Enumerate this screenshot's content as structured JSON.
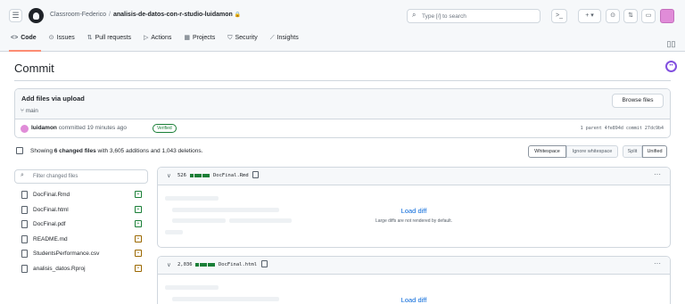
{
  "header": {
    "org": "Classroom-Federico",
    "separator": "/",
    "repo": "analisis-de-datos-con-r-studio-luidamon",
    "lock_glyph": "🔒",
    "search_placeholder": "Type [/] to search",
    "terminal_glyph": ">_",
    "plus_glyph": "+ ▾",
    "issues_glyph": "⊙",
    "pr_glyph": "⇅",
    "inbox_glyph": "▭"
  },
  "repo_nav": {
    "tabs": [
      {
        "icon": "<>",
        "label": "Code"
      },
      {
        "icon": "⊙",
        "label": "Issues"
      },
      {
        "icon": "⇅",
        "label": "Pull requests"
      },
      {
        "icon": "▷",
        "label": "Actions"
      },
      {
        "icon": "▦",
        "label": "Projects"
      },
      {
        "icon": "⛉",
        "label": "Security"
      },
      {
        "icon": "⟋",
        "label": "Insights"
      }
    ]
  },
  "page": {
    "title": "Commit"
  },
  "commit": {
    "message": "Add files via upload",
    "branch_glyph": "⑂",
    "branch": "main",
    "browse_label": "Browse files",
    "author": "luidamon",
    "committed_text": "committed 19 minutes ago",
    "verified_label": "Verified",
    "parent_text": "1 parent 4fe894d  commit 27dc9b4"
  },
  "summary": {
    "prefix": "Showing",
    "changed": "6 changed files",
    "with": "with",
    "additions": "3,605 additions",
    "and": "and",
    "deletions": "1,043 deletions."
  },
  "view_buttons": {
    "whitespace": "Whitespace",
    "ignore_whitespace": "Ignore whitespace",
    "split": "Split",
    "unified": "Unified"
  },
  "file_filter": {
    "placeholder": "Filter changed files"
  },
  "files": [
    {
      "name": "DocFinal.Rmd",
      "status": "added",
      "glyph": "+"
    },
    {
      "name": "DocFinal.html",
      "status": "added",
      "glyph": "+"
    },
    {
      "name": "DocFinal.pdf",
      "status": "added",
      "glyph": "+"
    },
    {
      "name": "README.md",
      "status": "modified",
      "glyph": "•"
    },
    {
      "name": "StudentsPerformance.csv",
      "status": "modified",
      "glyph": "•"
    },
    {
      "name": "analisis_datos.Rproj",
      "status": "modified",
      "glyph": "•"
    }
  ],
  "diffs": [
    {
      "count": "526",
      "file": "DocFinal.Rmd",
      "load_label": "Load diff",
      "note": "Large diffs are not rendered by default."
    },
    {
      "count": "2,036",
      "file": "DocFinal.html",
      "load_label": "Load diff"
    }
  ],
  "colors": {
    "accent_underline": "#fd8c73",
    "link": "#0969da",
    "added": "#1a7f37",
    "modified": "#9a6700",
    "border": "#d0d7de"
  }
}
